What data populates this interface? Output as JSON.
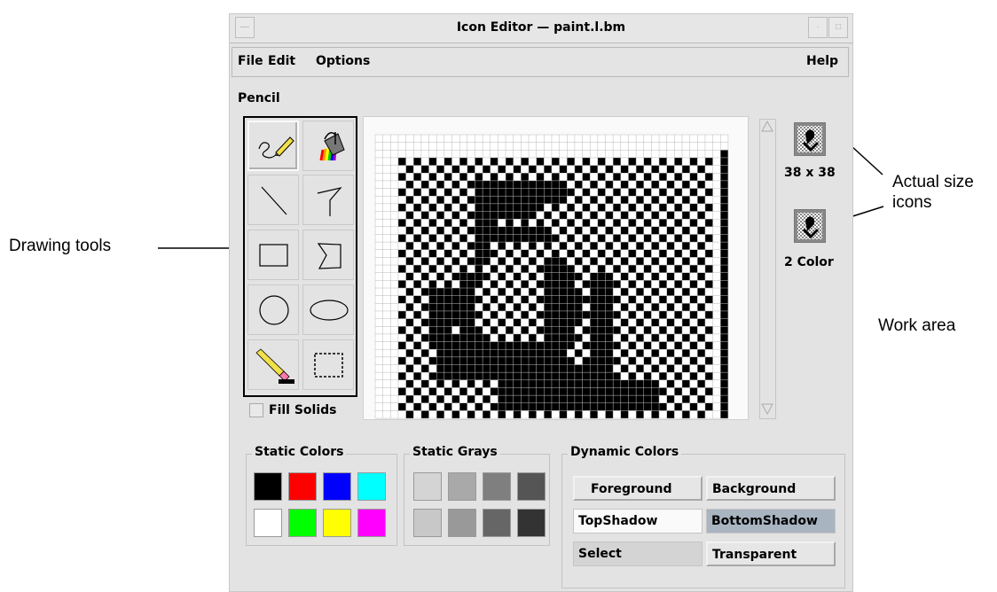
{
  "window": {
    "title": "Icon Editor — paint.l.bm",
    "menu": [
      "File",
      "Edit",
      "Options"
    ],
    "help": "Help"
  },
  "tool_label": "Pencil",
  "tools": [
    {
      "name": "pencil-tool",
      "icon": "pencil-icon"
    },
    {
      "name": "flood-fill-tool",
      "icon": "paint-bucket-icon"
    },
    {
      "name": "line-tool",
      "icon": "line-icon"
    },
    {
      "name": "polyline-tool",
      "icon": "polyline-icon"
    },
    {
      "name": "rectangle-tool",
      "icon": "rectangle-icon"
    },
    {
      "name": "polygon-tool",
      "icon": "polygon-icon"
    },
    {
      "name": "circle-tool",
      "icon": "circle-icon"
    },
    {
      "name": "ellipse-tool",
      "icon": "ellipse-icon"
    },
    {
      "name": "eraser-tool",
      "icon": "eraser-icon"
    },
    {
      "name": "select-tool",
      "icon": "marquee-icon"
    }
  ],
  "fill_solids": "Fill Solids",
  "icons": {
    "actual_size": "38 x 38",
    "two_color": "2 Color"
  },
  "static_colors": {
    "title": "Static Colors",
    "colors": [
      "#000000",
      "#ff0000",
      "#0000ff",
      "#00ffff",
      "#ffffff",
      "#00ff00",
      "#ffff00",
      "#ff00ff"
    ]
  },
  "static_grays": {
    "title": "Static Grays",
    "colors": [
      "#d4d4d4",
      "#a9a9a9",
      "#7f7f7f",
      "#555555",
      "#c8c8c8",
      "#999999",
      "#666666",
      "#333333"
    ]
  },
  "dynamic_colors": {
    "title": "Dynamic Colors",
    "buttons": [
      "Foreground",
      "Background",
      "TopShadow",
      "BottomShadow",
      "Select",
      "Transparent"
    ]
  },
  "callouts": {
    "drawing_tools": "Drawing tools",
    "actual_size": "Actual size",
    "actual_size_2": "icons",
    "work_area": "Work area"
  }
}
